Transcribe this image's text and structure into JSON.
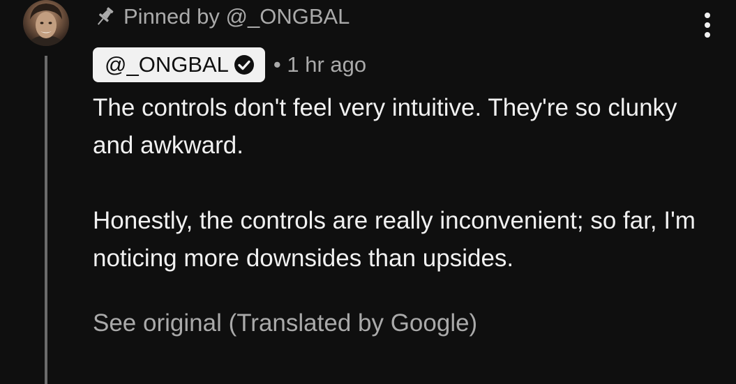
{
  "pinned": {
    "icon": "pin-icon",
    "text": "Pinned by @_ONGBAL"
  },
  "comment": {
    "avatar": "avatar",
    "author": "@_ONGBAL",
    "verified_icon": "verified-checkmark-icon",
    "time": "• 1 hr ago",
    "paragraphs": [
      "The controls don't feel very intuitive. They're so clunky and awkward.",
      "Honestly, the controls are really inconvenient; so far, I'm noticing more downsides than upsides."
    ],
    "translation_link": "See original (Translated by Google)"
  },
  "menu": {
    "icon": "more-vertical-icon"
  },
  "colors": {
    "background": "#0f0f0f",
    "text_primary": "#f1f1f1",
    "text_secondary": "#aaaaaa",
    "author_chip_bg": "#f1f1f1",
    "thread_line": "#6b6b6b"
  }
}
